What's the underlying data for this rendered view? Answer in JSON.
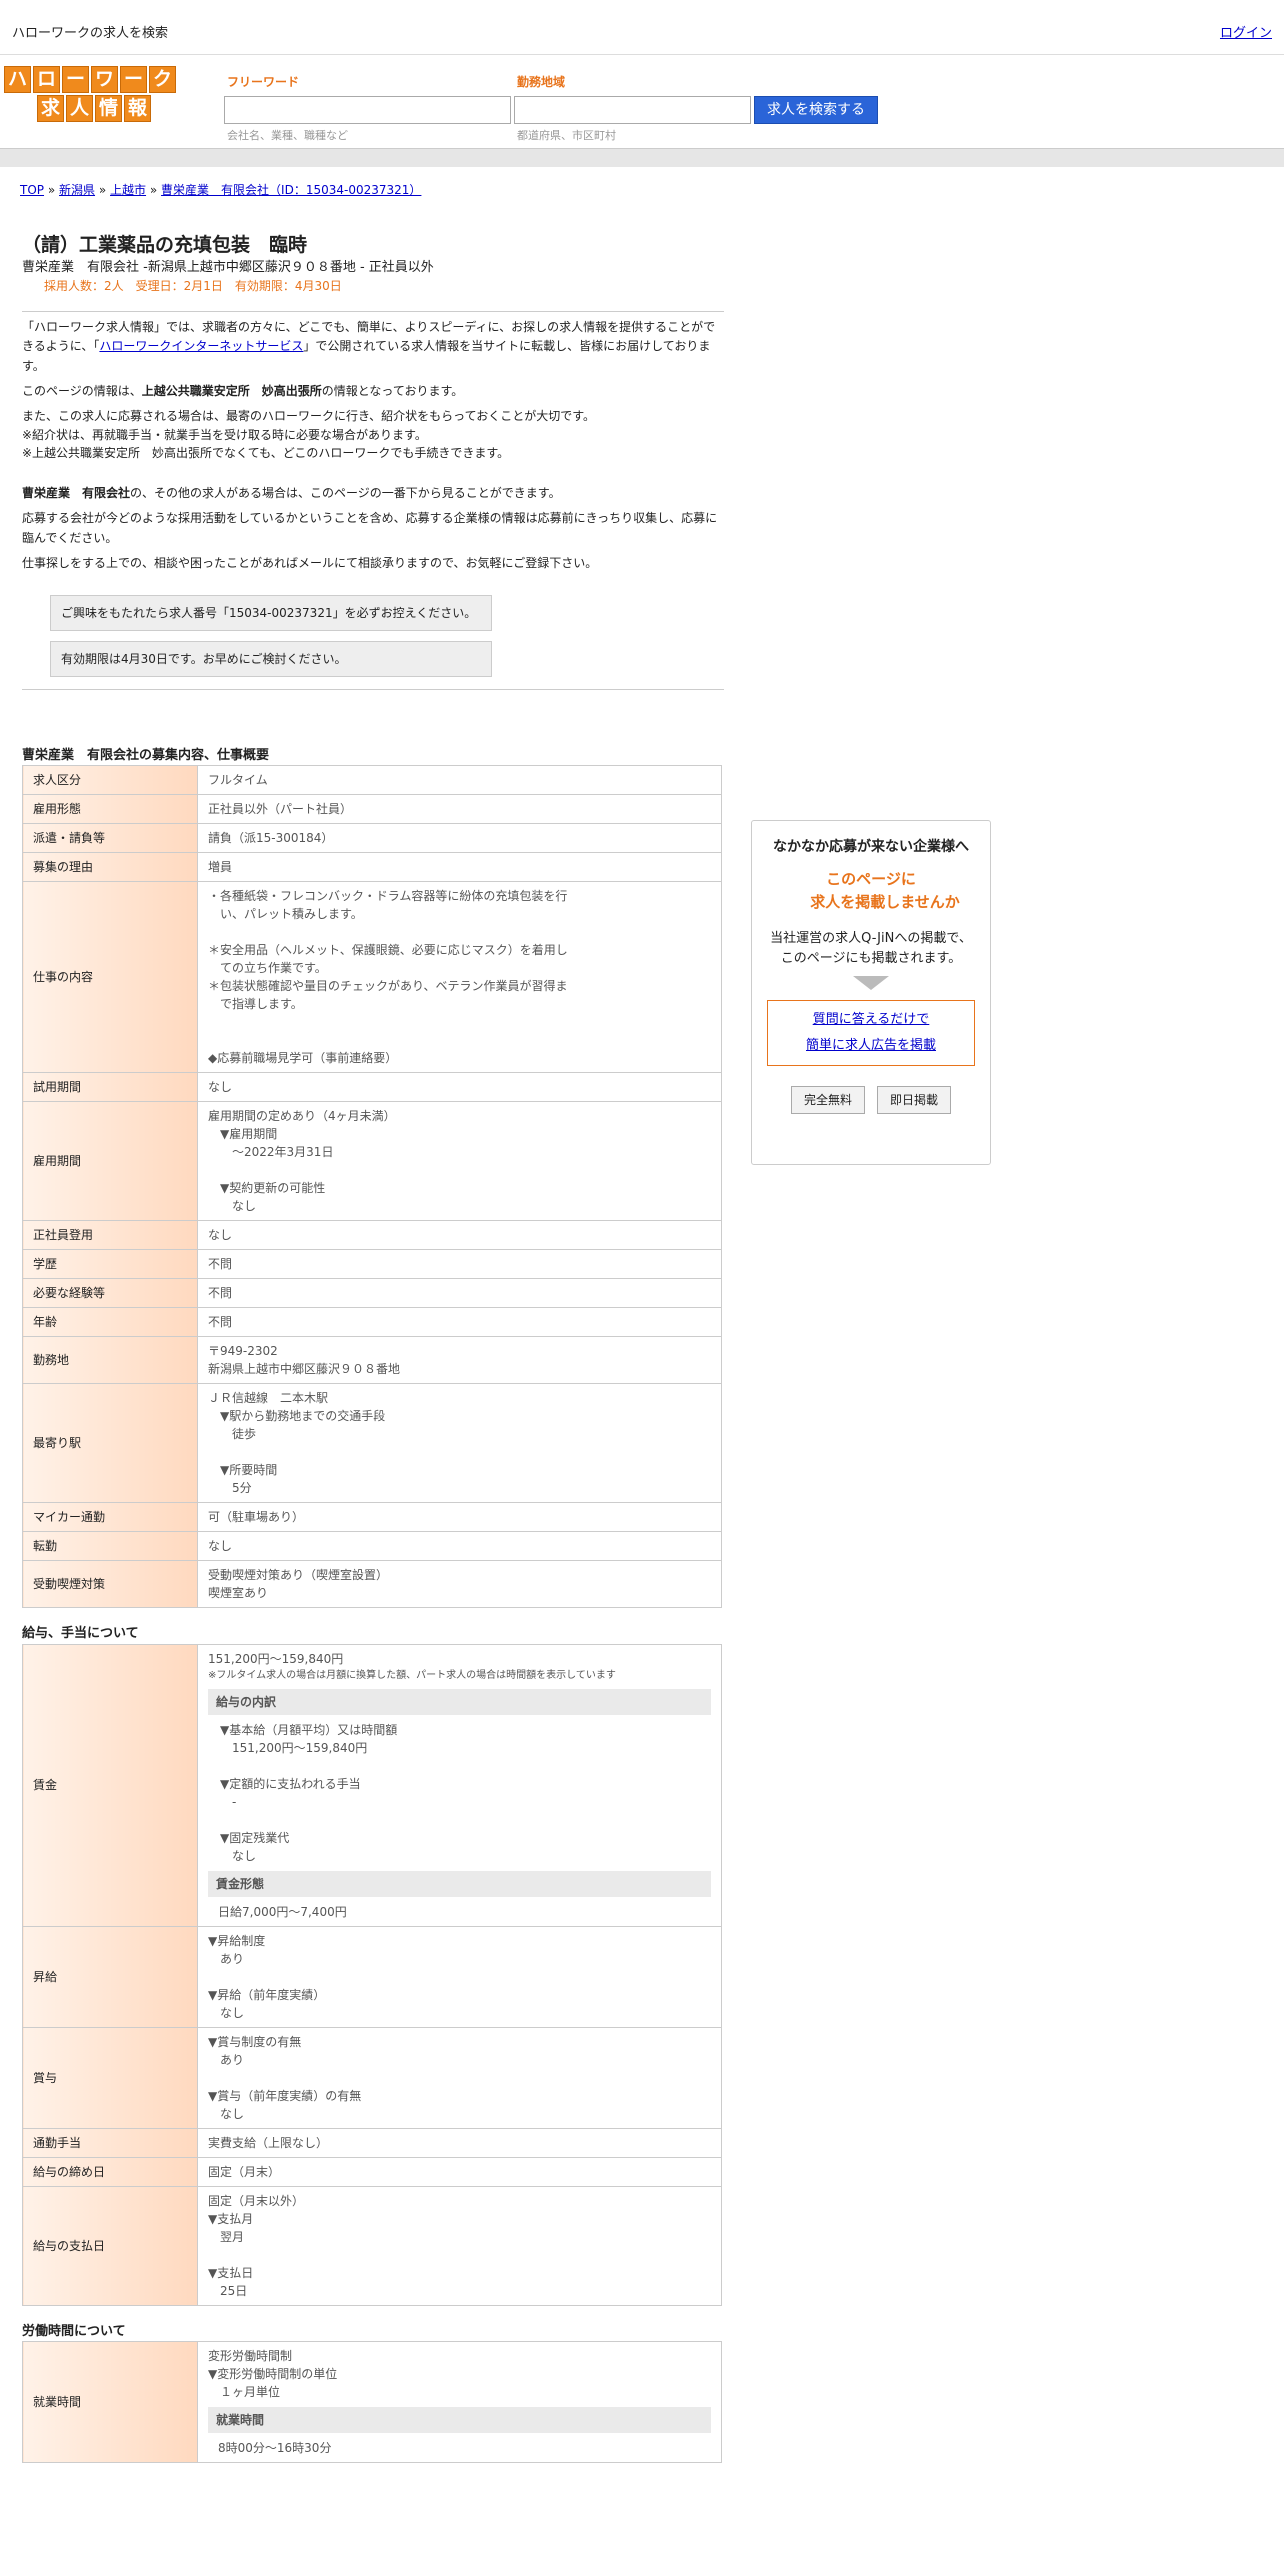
{
  "header": {
    "site_title": "ハローワークの求人を検索",
    "login": "ログイン"
  },
  "logo": {
    "row1": [
      "ハ",
      "ロ",
      "ー",
      "ワ",
      "ー",
      "ク"
    ],
    "row2": [
      "求",
      "人",
      "情",
      "報"
    ]
  },
  "search": {
    "keyword_label": "フリーワード",
    "keyword_hint": "会社名、業種、職種など",
    "area_label": "勤務地域",
    "area_hint": "都道府県、市区町村",
    "button": "求人を検索する"
  },
  "breadcrumb": {
    "top": "TOP",
    "pref": "新潟県",
    "city": "上越市",
    "company": "曹栄産業　有限会社（ID：15034-00237321）",
    "sep": "»"
  },
  "job": {
    "title": "（請）工業薬品の充填包装　臨時",
    "subtitle": "曹栄産業　有限会社 -新潟県上越市中郷区藤沢９０８番地 - 正社員以外",
    "meta": "採用人数：2人　受理日：2月1日　有効期限：4月30日"
  },
  "intro": {
    "p1a": "「ハローワーク求人情報」では、求職者の方々に、どこでも、簡単に、よりスピーディに、お探しの求人情報を提供することができるように、「",
    "p1link": "ハローワークインターネットサービス",
    "p1b": "」で公開されている求人情報を当サイトに転載し、皆様にお届けしております。",
    "p2a": "このページの情報は、",
    "p2b": "上越公共職業安定所　妙高出張所",
    "p2c": "の情報となっております。",
    "p3": "また、この求人に応募される場合は、最寄のハローワークに行き、紹介状をもらっておくことが大切です。",
    "p4": "※紹介状は、再就職手当・就業手当を受け取る時に必要な場合があります。",
    "p5": "※上越公共職業安定所　妙高出張所でなくても、どこのハローワークでも手続きできます。",
    "p6a": "曹栄産業　有限会社",
    "p6b": "の、その他の求人がある場合は、このページの一番下から見ることができます。",
    "p7": "応募する会社が今どのような採用活動をしているかということを含め、応募する企業様の情報は応募前にきっちり収集し、応募に臨んでください。",
    "p8": "仕事探しをする上での、相談や困ったことがあればメールにて相談承りますので、お気軽にご登録下さい。",
    "note1": "ご興味をもたれたら求人番号「15034-00237321」を必ずお控えください。",
    "note2": "有効期限は4月30日です。お早めにご検討ください。"
  },
  "sections": {
    "overview": "曹栄産業　有限会社の募集内容、仕事概要",
    "salary": "給与、手当について",
    "hours": "労働時間について"
  },
  "overview_rows": [
    {
      "k": "求人区分",
      "v": "フルタイム"
    },
    {
      "k": "雇用形態",
      "v": "正社員以外（パート社員）"
    },
    {
      "k": "派遣・請負等",
      "v": "請負（派15-300184）"
    },
    {
      "k": "募集の理由",
      "v": "増員"
    },
    {
      "k": "仕事の内容",
      "v": "・各種紙袋・フレコンバック・ドラム容器等に紛体の充填包装を行\n　い、パレット積みします。\n\n＊安全用品（ヘルメット、保護眼鏡、必要に応じマスク）を着用し\n　ての立ち作業です。\n＊包装状態確認や量目のチェックがあり、ベテラン作業員が習得ま\n　で指導します。\n\n\n◆応募前職場見学可（事前連絡要）"
    },
    {
      "k": "試用期間",
      "v": "なし"
    },
    {
      "k": "雇用期間",
      "v": "雇用期間の定めあり（4ヶ月未満）\n　▼雇用期間\n　　〜2022年3月31日\n\n　▼契約更新の可能性\n　　なし"
    },
    {
      "k": "正社員登用",
      "v": "なし"
    },
    {
      "k": "学歴",
      "v": "不問"
    },
    {
      "k": "必要な経験等",
      "v": "不問"
    },
    {
      "k": "年齢",
      "v": "不問"
    },
    {
      "k": "勤務地",
      "v": "〒949-2302\n新潟県上越市中郷区藤沢９０８番地"
    },
    {
      "k": "最寄り駅",
      "v": "ＪＲ信越線　二本木駅\n　▼駅から勤務地までの交通手段\n　　徒歩\n\n　▼所要時間\n　　5分"
    },
    {
      "k": "マイカー通勤",
      "v": "可（駐車場あり）"
    },
    {
      "k": "転勤",
      "v": "なし"
    },
    {
      "k": "受動喫煙対策",
      "v": "受動喫煙対策あり（喫煙室設置）\n喫煙室あり"
    }
  ],
  "salary": {
    "wage_label": "賃金",
    "wage": "151,200円〜159,840円",
    "wage_note": "※フルタイム求人の場合は月額に換算した額、パート求人の場合は時間額を表示しています",
    "breakdown_h": "給与の内訳",
    "breakdown": "　▼基本給（月額平均）又は時間額\n　　151,200円〜159,840円\n\n　▼定額的に支払われる手当\n　　-\n\n　▼固定残業代\n　　なし",
    "form_h": "賃金形態",
    "form": "日給7,000円〜7,400円",
    "rows": [
      {
        "k": "昇給",
        "v": "▼昇給制度\n　あり\n\n▼昇給（前年度実績）\n　なし"
      },
      {
        "k": "賞与",
        "v": "▼賞与制度の有無\n　あり\n\n▼賞与（前年度実績）の有無\n　なし"
      },
      {
        "k": "通勤手当",
        "v": "実費支給（上限なし）"
      },
      {
        "k": "給与の締め日",
        "v": "固定（月末）"
      },
      {
        "k": "給与の支払日",
        "v": "固定（月末以外）\n▼支払月\n　翌月\n\n▼支払日\n　25日"
      }
    ]
  },
  "hours": {
    "k": "就業時間",
    "v": "変形労働時間制\n▼変形労働時間制の単位\n　１ヶ月単位",
    "inner_h": "就業時間",
    "inner_v": "8時00分〜16時30分"
  },
  "sidebar": {
    "title": "なかなか応募が来ない企業様へ",
    "hl1": "このページに",
    "hl2": "求人を掲載しませんか",
    "desc1": "当社運営の求人Q-JiNへの掲載で、",
    "desc2": "このページにも掲載されます。",
    "link1": "質問に答えるだけで",
    "link2": "簡単に求人広告を掲載",
    "btn1": "完全無料",
    "btn2": "即日掲載"
  }
}
